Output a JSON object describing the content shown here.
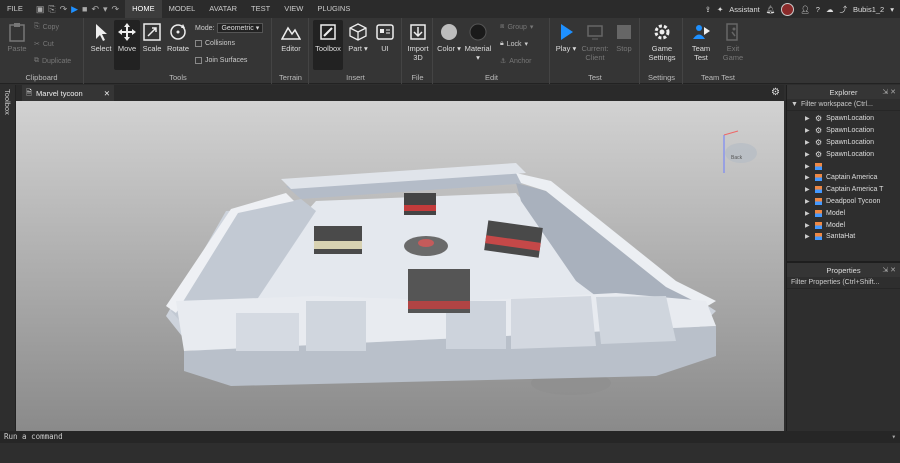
{
  "menubar": {
    "file": "FILE",
    "tabs": [
      "HOME",
      "MODEL",
      "AVATAR",
      "TEST",
      "VIEW",
      "PLUGINS"
    ],
    "active_tab": "HOME",
    "assistant": "Assistant",
    "username": "Bubis1_2"
  },
  "ribbon": {
    "clipboard": {
      "paste": "Paste",
      "copy": "Copy",
      "cut": "Cut",
      "duplicate": "Duplicate",
      "label": "Clipboard"
    },
    "tools": {
      "select": "Select",
      "move": "Move",
      "scale": "Scale",
      "rotate": "Rotate",
      "mode_label": "Mode:",
      "mode_value": "Geometric",
      "collisions": "Collisions",
      "join_surfaces": "Join Surfaces",
      "label": "Tools"
    },
    "terrain": {
      "editor": "Editor",
      "label": "Terrain"
    },
    "insert": {
      "toolbox": "Toolbox",
      "part": "Part",
      "ui": "UI",
      "label": "Insert"
    },
    "file": {
      "import3d_1": "Import",
      "import3d_2": "3D",
      "label": "File"
    },
    "edit": {
      "color": "Color",
      "material": "Material",
      "group": "Group",
      "lock": "Lock",
      "anchor": "Anchor",
      "label": "Edit"
    },
    "test": {
      "play": "Play",
      "current_1": "Current:",
      "current_2": "Client",
      "stop": "Stop",
      "label": "Test"
    },
    "settings": {
      "game_1": "Game",
      "game_2": "Settings",
      "label": "Settings"
    },
    "team_test": {
      "team_1": "Team",
      "team_2": "Test",
      "exit_1": "Exit",
      "exit_2": "Game",
      "label": "Team Test"
    }
  },
  "toolbox_strip": "Toolbox",
  "document_tab": {
    "label": "Marvel tycoon",
    "close": "✕"
  },
  "viewport": {
    "view_cube_label": "Back"
  },
  "explorer": {
    "title": "Explorer",
    "filter_placeholder": "Filter workspace (Ctrl...",
    "items": [
      {
        "name": "SpawnLocation",
        "icon": "spawn-gear"
      },
      {
        "name": "SpawnLocation",
        "icon": "spawn-gear"
      },
      {
        "name": "SpawnLocation",
        "icon": "spawn-gear"
      },
      {
        "name": "SpawnLocation",
        "icon": "spawn-gear"
      },
      {
        "name": "",
        "icon": "model"
      },
      {
        "name": "Captain America",
        "icon": "model"
      },
      {
        "name": "Captain America T",
        "icon": "model"
      },
      {
        "name": "Deadpool Tycoon",
        "icon": "model"
      },
      {
        "name": "Model",
        "icon": "model"
      },
      {
        "name": "Model",
        "icon": "model"
      },
      {
        "name": "SantaHat",
        "icon": "model"
      }
    ]
  },
  "properties": {
    "title": "Properties",
    "filter_placeholder": "Filter Properties (Ctrl+Shift..."
  },
  "command_bar": {
    "placeholder": "Run a command"
  },
  "colors": {
    "accent": "#1e90ff",
    "panel": "#2e2e2e",
    "ribbon": "#353535"
  }
}
